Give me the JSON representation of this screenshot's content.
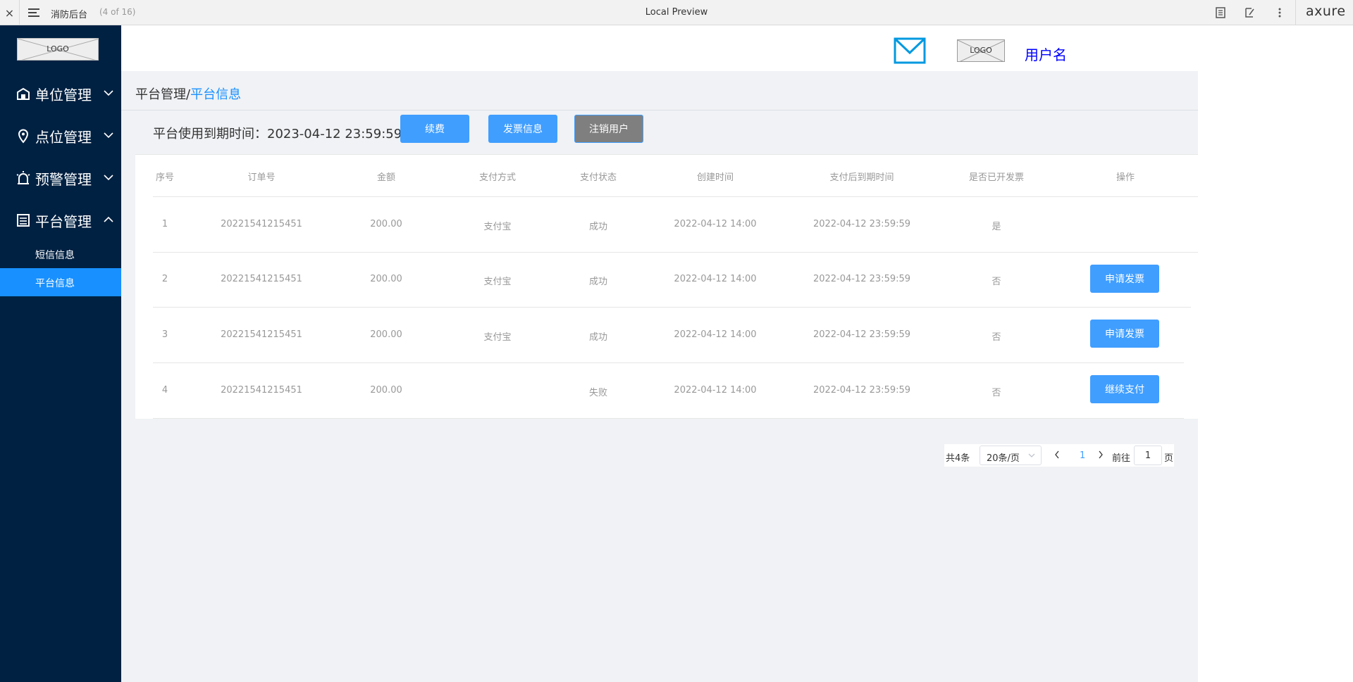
{
  "topbar": {
    "close_glyph": "×",
    "project_name": "消防后台",
    "page_count": "(4 of 16)",
    "preview_title": "Local Preview",
    "brand": "axure",
    "icons": [
      "notes-icon",
      "annotate-icon",
      "more-icon"
    ]
  },
  "sidebar": {
    "logo": "LOGO",
    "nav": [
      {
        "label": "单位管理",
        "icon": "building-icon",
        "expanded": false
      },
      {
        "label": "点位管理",
        "icon": "location-pin-icon",
        "expanded": false
      },
      {
        "label": "预警管理",
        "icon": "alarm-icon",
        "expanded": false
      },
      {
        "label": "平台管理",
        "icon": "platform-icon",
        "expanded": true
      }
    ],
    "sub": [
      {
        "label": "短信信息",
        "active": false
      },
      {
        "label": "平台信息",
        "active": true
      }
    ]
  },
  "header": {
    "logo": "LOGO",
    "username": "用户名",
    "mail_icon": "mail-icon"
  },
  "breadcrumb": {
    "parent": "平台管理",
    "separator": "/",
    "current": "平台信息"
  },
  "expire": {
    "text": "平台使用到期时间：2023-04-12 23:59:59"
  },
  "actions": {
    "renew": "续费",
    "invoice_info": "发票信息",
    "cancel_user": "注销用户"
  },
  "table": {
    "headers": [
      "序号",
      "订单号",
      "金额",
      "支付方式",
      "支付状态",
      "创建时间",
      "支付后到期时间",
      "是否已开发票",
      "操作"
    ],
    "rows": [
      {
        "no": "1",
        "order": "20221541215451",
        "amount": "200.00",
        "method": "支付宝",
        "status": "成功",
        "created": "2022-04-12 14:00",
        "expire": "2022-04-12 23:59:59",
        "invoiced": "是",
        "op": ""
      },
      {
        "no": "2",
        "order": "20221541215451",
        "amount": "200.00",
        "method": "支付宝",
        "status": "成功",
        "created": "2022-04-12 14:00",
        "expire": "2022-04-12 23:59:59",
        "invoiced": "否",
        "op": "申请发票"
      },
      {
        "no": "3",
        "order": "20221541215451",
        "amount": "200.00",
        "method": "支付宝",
        "status": "成功",
        "created": "2022-04-12 14:00",
        "expire": "2022-04-12 23:59:59",
        "invoiced": "否",
        "op": "申请发票"
      },
      {
        "no": "4",
        "order": "20221541215451",
        "amount": "200.00",
        "method": "",
        "status": "失败",
        "created": "2022-04-12 14:00",
        "expire": "2022-04-12 23:59:59",
        "invoiced": "否",
        "op": "继续支付"
      }
    ]
  },
  "pagination": {
    "total": "共4条",
    "page_size": "20条/页",
    "current": "1",
    "goto_label": "前往",
    "goto_value": "1",
    "unit": "页"
  },
  "colors": {
    "sidebar_bg": "#002142",
    "accent": "#1890ff",
    "button_blue": "#409eff",
    "button_gray": "#7f7f7f",
    "username": "#0000ff"
  }
}
